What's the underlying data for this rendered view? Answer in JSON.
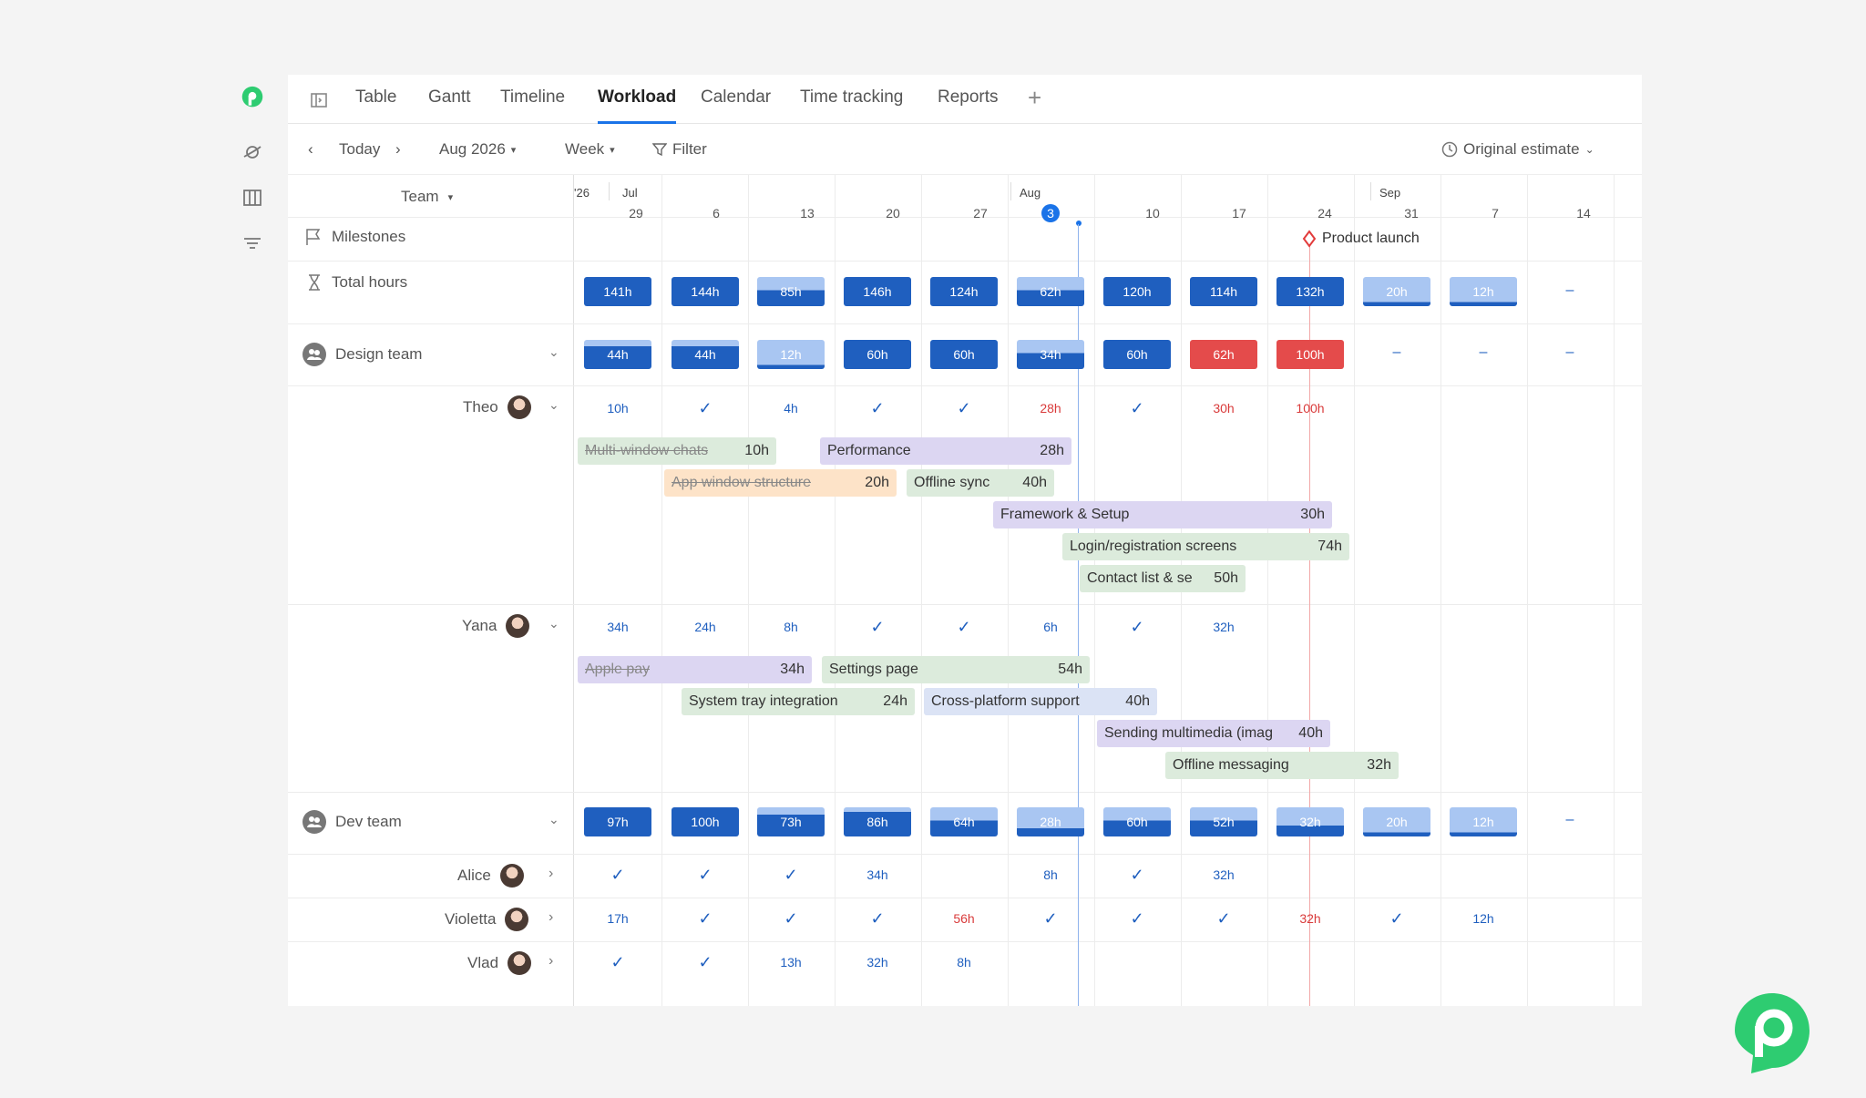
{
  "tabs": [
    "Table",
    "Gantt",
    "Timeline",
    "Workload",
    "Calendar",
    "Time tracking",
    "Reports"
  ],
  "active_tab": "Workload",
  "toolbar": {
    "today": "Today",
    "month": "Aug 2026",
    "scale": "Week",
    "filter": "Filter",
    "estimate": "Original estimate"
  },
  "grid": {
    "team_label": "Team",
    "months": [
      "'26",
      "Jul",
      "Aug",
      "Sep"
    ],
    "days": [
      "29",
      "6",
      "13",
      "20",
      "27",
      "3",
      "10",
      "17",
      "24",
      "31",
      "7",
      "14"
    ],
    "today_index": 5,
    "milestones_label": "Milestones",
    "total_hours_label": "Total hours",
    "milestone_name": "Product launch"
  },
  "total_hours": [
    "141h",
    "144h",
    "85h",
    "146h",
    "124h",
    "62h",
    "120h",
    "114h",
    "132h",
    "20h",
    "12h",
    "–"
  ],
  "design_team": {
    "name": "Design team",
    "hours": [
      "44h",
      "44h",
      "12h",
      "60h",
      "60h",
      "34h",
      "60h",
      "62h",
      "100h",
      "–",
      "–",
      "–"
    ],
    "theo": {
      "name": "Theo",
      "cells": [
        "10h",
        "✓",
        "4h",
        "✓",
        "✓",
        "28h",
        "✓",
        "30h",
        "100h"
      ],
      "tasks": [
        {
          "name": "Multi-window chats",
          "hours": "10h"
        },
        {
          "name": "Performance",
          "hours": "28h"
        },
        {
          "name": "App window structure",
          "hours": "20h"
        },
        {
          "name": "Offline sync",
          "hours": "40h"
        },
        {
          "name": "Framework & Setup",
          "hours": "30h"
        },
        {
          "name": "Login/registration screens",
          "hours": "74h"
        },
        {
          "name": "Contact list & se",
          "hours": "50h"
        }
      ]
    },
    "yana": {
      "name": "Yana",
      "cells": [
        "34h",
        "24h",
        "8h",
        "✓",
        "✓",
        "6h",
        "✓",
        "32h"
      ],
      "tasks": [
        {
          "name": "Apple pay",
          "hours": "34h"
        },
        {
          "name": "Settings page",
          "hours": "54h"
        },
        {
          "name": "System tray integration",
          "hours": "24h"
        },
        {
          "name": "Cross-platform support",
          "hours": "40h"
        },
        {
          "name": "Sending multimedia (imag",
          "hours": "40h"
        },
        {
          "name": "Offline messaging",
          "hours": "32h"
        }
      ]
    }
  },
  "dev_team": {
    "name": "Dev team",
    "hours": [
      "97h",
      "100h",
      "73h",
      "86h",
      "64h",
      "28h",
      "60h",
      "52h",
      "32h",
      "20h",
      "12h",
      "–"
    ],
    "alice": {
      "name": "Alice",
      "cells": [
        "✓",
        "✓",
        "✓",
        "34h",
        "",
        "8h",
        "✓",
        "32h"
      ]
    },
    "violetta": {
      "name": "Violetta",
      "cells": [
        "17h",
        "✓",
        "✓",
        "✓",
        "56h",
        "✓",
        "✓",
        "✓",
        "32h",
        "✓",
        "12h"
      ]
    },
    "vlad": {
      "name": "Vlad",
      "cells": [
        "✓",
        "✓",
        "13h",
        "32h",
        "8h"
      ]
    }
  },
  "colors": {
    "accent": "#1a73e8",
    "chip": "#1f5fbf",
    "over": "#e44b4b",
    "brand": "#2ecc71"
  }
}
